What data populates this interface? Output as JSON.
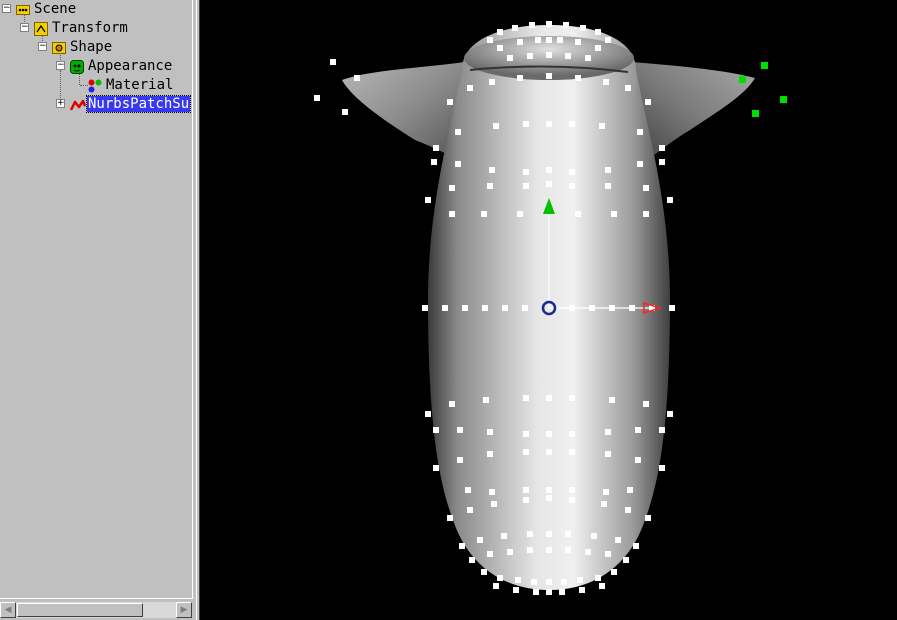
{
  "tree": {
    "nodes": [
      {
        "label": "Scene",
        "icon": "scene-icon"
      },
      {
        "label": "Transform",
        "icon": "transform-icon"
      },
      {
        "label": "Shape",
        "icon": "shape-icon"
      },
      {
        "label": "Appearance",
        "icon": "appearance-icon"
      },
      {
        "label": "Material",
        "icon": "material-icon"
      },
      {
        "label": "NurbsPatchSu",
        "icon": "nurbs-patch-icon",
        "selected": true
      }
    ]
  },
  "viewport": {
    "background": "#000000",
    "control_point_color": "#ffffff",
    "selected_point_color": "#00e000",
    "manipulator": {
      "y_axis_color": "#00c000",
      "x_axis_color": "#ff2020",
      "center_color": "#1a2a8a"
    }
  }
}
